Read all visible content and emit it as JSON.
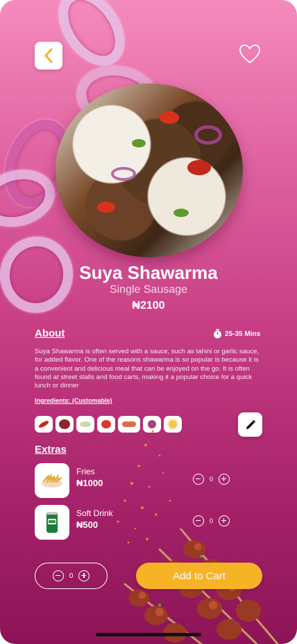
{
  "product": {
    "name": "Suya Shawarma",
    "variant": "Single Sausage",
    "price": "₦2100"
  },
  "about": {
    "heading": "About",
    "time": "25-35 Mins",
    "description": "Suya Shawarma is often served with a sauce, such as tahini or garlic sauce, for added flavor. One of the reasons shawarma is so popular is because it is a convenient and delicious meal that can be enjoyed on the go. It is often found at street stalls and food carts, making it a popular choice for a quick lunch or dinner"
  },
  "ingredients": {
    "heading": "Ingredients: (Customable)",
    "items": [
      {
        "icon": "chili-icon",
        "color": "#c2281c"
      },
      {
        "icon": "meat-icon",
        "color": "#8e2733"
      },
      {
        "icon": "cabbage-icon",
        "color": "#cfd6a8"
      },
      {
        "icon": "tomato-icon",
        "color": "#e0362a"
      },
      {
        "icon": "sausage-icon",
        "color": "#e06b4a"
      },
      {
        "icon": "onion-icon",
        "color": "#a5457a"
      },
      {
        "icon": "egg-icon",
        "color": "#f2c84b"
      }
    ]
  },
  "extras": {
    "heading": "Extras",
    "items": [
      {
        "name": "Fries",
        "price": "₦1000",
        "qty": "0"
      },
      {
        "name": "Soft Drink",
        "price": "₦500",
        "qty": "0"
      }
    ]
  },
  "cart": {
    "qty": "0",
    "button_label": "Add to Cart"
  },
  "colors": {
    "accent": "#f6b325",
    "background_top": "#f58bbd",
    "background_bottom": "#8c1456"
  }
}
